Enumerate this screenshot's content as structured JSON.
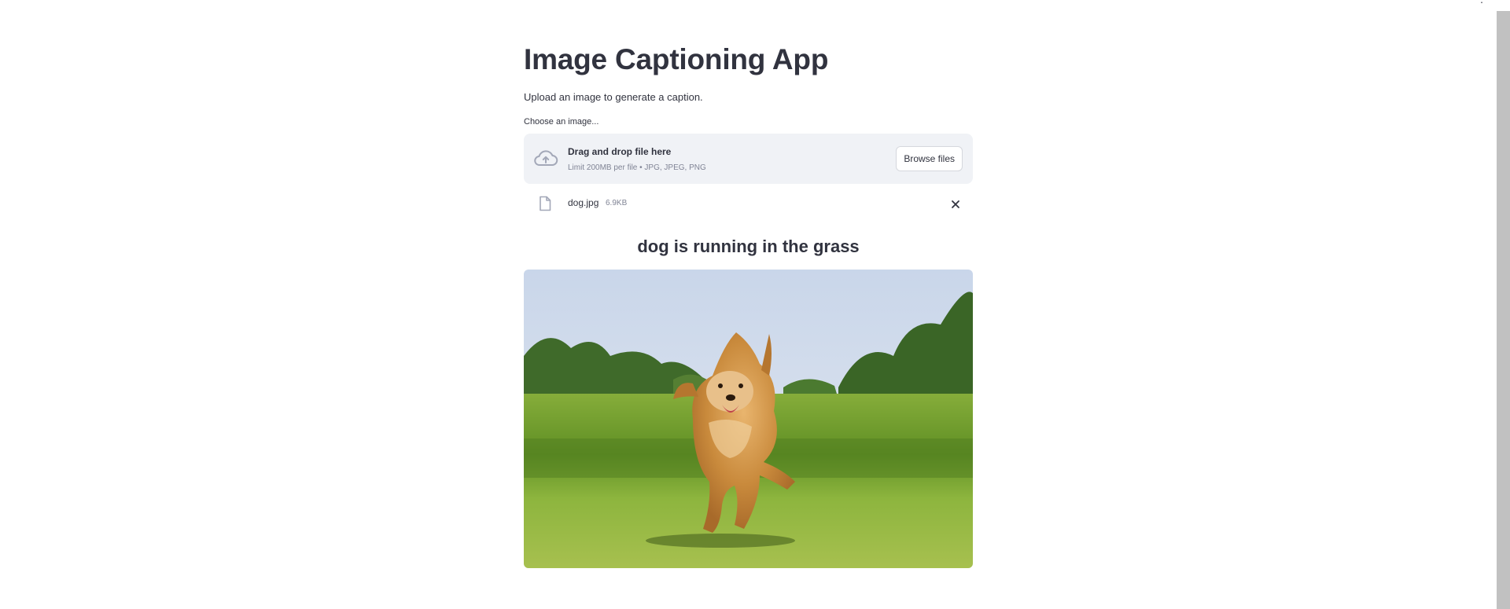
{
  "app": {
    "title": "Image Captioning App",
    "subtitle": "Upload an image to generate a caption."
  },
  "uploader": {
    "label": "Choose an image...",
    "dropzone_title": "Drag and drop file here",
    "dropzone_hint": "Limit 200MB per file • JPG, JPEG, PNG",
    "browse_label": "Browse files",
    "upload_icon": "cloud-upload-icon"
  },
  "uploaded_file": {
    "name": "dog.jpg",
    "size": "6.9KB",
    "file_icon": "file-icon",
    "remove_icon": "close-icon"
  },
  "result": {
    "caption": "dog is running in the grass"
  },
  "colors": {
    "text": "#31333f",
    "muted": "#808495",
    "dropzone_bg": "#f0f2f6",
    "icon": "#a3a8b8"
  }
}
